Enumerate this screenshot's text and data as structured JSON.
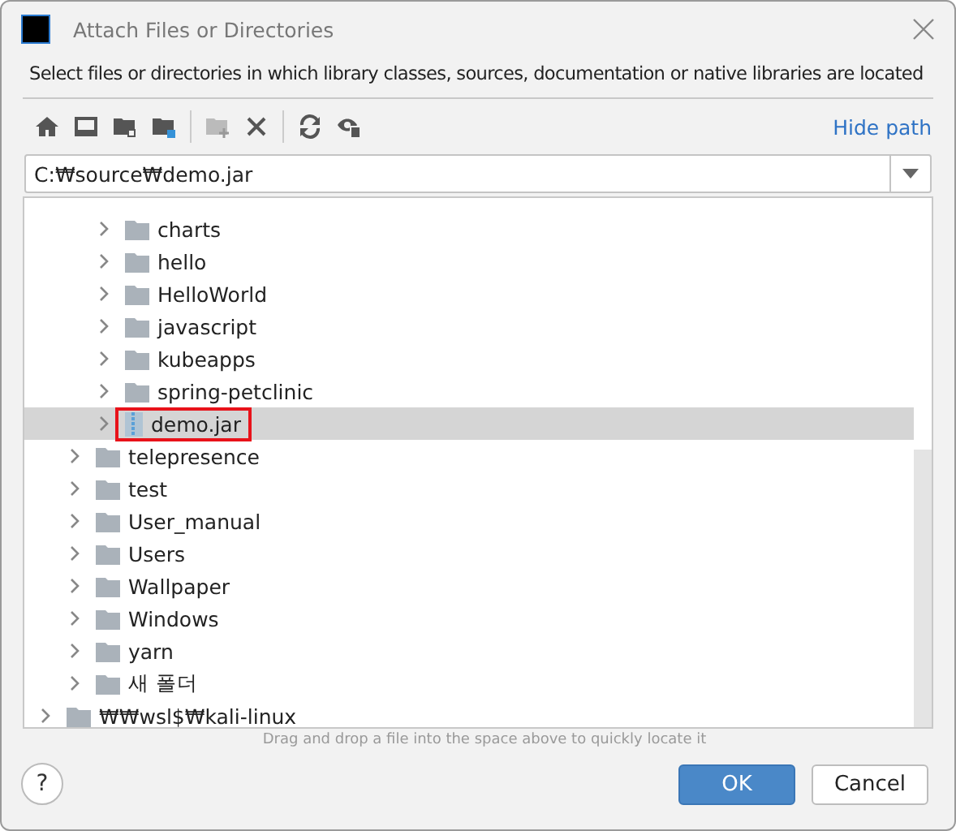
{
  "window": {
    "title": "Attach Files or Directories"
  },
  "description": "Select files or directories in which library classes, sources, documentation or native libraries are located",
  "toolbar": {
    "hide_path": "Hide path"
  },
  "path_field": {
    "value": "C:₩source₩demo.jar"
  },
  "tree": {
    "items": [
      {
        "children": [
          {
            "children": [
              {
                "label": "charts",
                "kind": "folder",
                "expanded": false,
                "selected": false,
                "marked": false
              },
              {
                "label": "hello",
                "kind": "folder",
                "expanded": false,
                "selected": false,
                "marked": false
              },
              {
                "label": "HelloWorld",
                "kind": "folder",
                "expanded": false,
                "selected": false,
                "marked": false
              },
              {
                "label": "javascript",
                "kind": "folder",
                "expanded": false,
                "selected": false,
                "marked": false
              },
              {
                "label": "kubeapps",
                "kind": "folder",
                "expanded": false,
                "selected": false,
                "marked": false
              },
              {
                "label": "spring-petclinic",
                "kind": "folder",
                "expanded": false,
                "selected": false,
                "marked": false
              },
              {
                "label": "demo.jar",
                "kind": "jar",
                "expanded": false,
                "selected": true,
                "marked": true
              }
            ]
          },
          {
            "label": "telepresence",
            "kind": "folder",
            "expanded": false,
            "selected": false,
            "marked": false
          },
          {
            "label": "test",
            "kind": "folder",
            "expanded": false,
            "selected": false,
            "marked": false
          },
          {
            "label": "User_manual",
            "kind": "folder",
            "expanded": false,
            "selected": false,
            "marked": false
          },
          {
            "label": "Users",
            "kind": "folder",
            "expanded": false,
            "selected": false,
            "marked": false
          },
          {
            "label": "Wallpaper",
            "kind": "folder",
            "expanded": false,
            "selected": false,
            "marked": false
          },
          {
            "label": "Windows",
            "kind": "folder",
            "expanded": false,
            "selected": false,
            "marked": false
          },
          {
            "label": "yarn",
            "kind": "folder",
            "expanded": false,
            "selected": false,
            "marked": false
          },
          {
            "label": "새 폴더",
            "kind": "folder",
            "expanded": false,
            "selected": false,
            "marked": false
          }
        ]
      },
      {
        "label": "₩₩wsl$₩kali-linux",
        "kind": "folder",
        "expanded": false,
        "selected": false,
        "marked": false
      }
    ]
  },
  "hint": "Drag and drop a file into the space above to quickly locate it",
  "buttons": {
    "help": "?",
    "ok": "OK",
    "cancel": "Cancel"
  }
}
